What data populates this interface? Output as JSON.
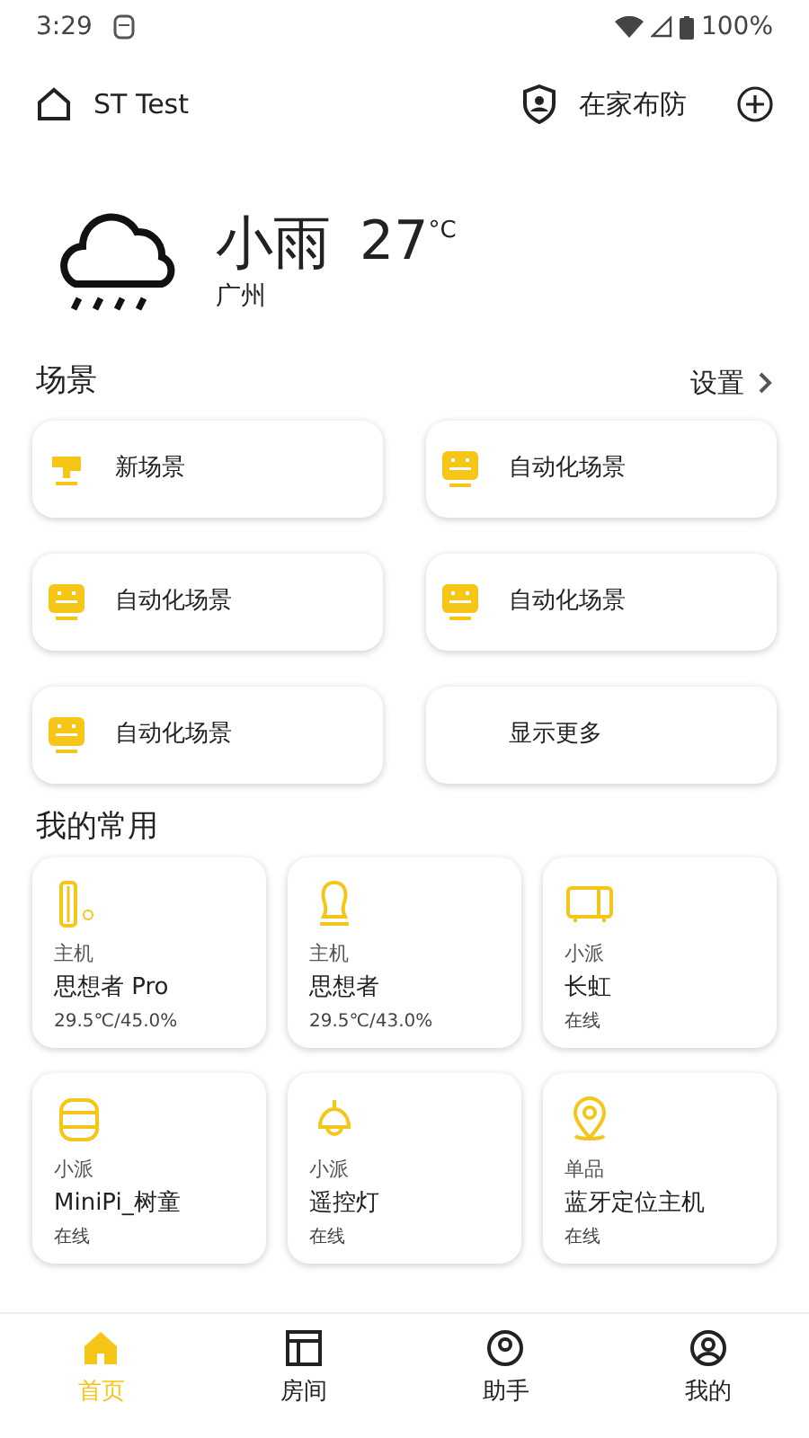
{
  "status_bar": {
    "time": "3:29",
    "battery": "100%"
  },
  "header": {
    "home": "ST Test",
    "arm_mode": "在家布防"
  },
  "weather": {
    "condition": "小雨",
    "temperature": "27",
    "unit": "°C",
    "city": "广州"
  },
  "scenes": {
    "title": "场景",
    "settings": "设置",
    "items": [
      {
        "kind": "manual",
        "label": "新场景"
      },
      {
        "kind": "auto",
        "label": "自动化场景"
      },
      {
        "kind": "auto",
        "label": "自动化场景"
      },
      {
        "kind": "auto",
        "label": "自动化场景"
      },
      {
        "kind": "auto",
        "label": "自动化场景"
      },
      {
        "kind": "more",
        "label": "显示更多"
      }
    ]
  },
  "favorites": {
    "title": "我的常用",
    "items": [
      {
        "kind": "tower",
        "type": "主机",
        "name": "思想者 Pro",
        "status": "29.5℃/45.0%"
      },
      {
        "kind": "head",
        "type": "主机",
        "name": "思想者",
        "status": "29.5℃/43.0%"
      },
      {
        "kind": "tv",
        "type": "小派",
        "name": "长虹",
        "status": "在线"
      },
      {
        "kind": "can",
        "type": "小派",
        "name": "MiniPi_树童",
        "status": "在线"
      },
      {
        "kind": "lamp",
        "type": "小派",
        "name": "遥控灯",
        "status": "在线"
      },
      {
        "kind": "pin",
        "type": "单品",
        "name": "蓝牙定位主机",
        "status": "在线"
      }
    ]
  },
  "nav": [
    {
      "kind": "home",
      "label": "首页",
      "selected": true
    },
    {
      "kind": "room",
      "label": "房间",
      "selected": false
    },
    {
      "kind": "assistant",
      "label": "助手",
      "selected": false
    },
    {
      "kind": "me",
      "label": "我的",
      "selected": false
    }
  ]
}
